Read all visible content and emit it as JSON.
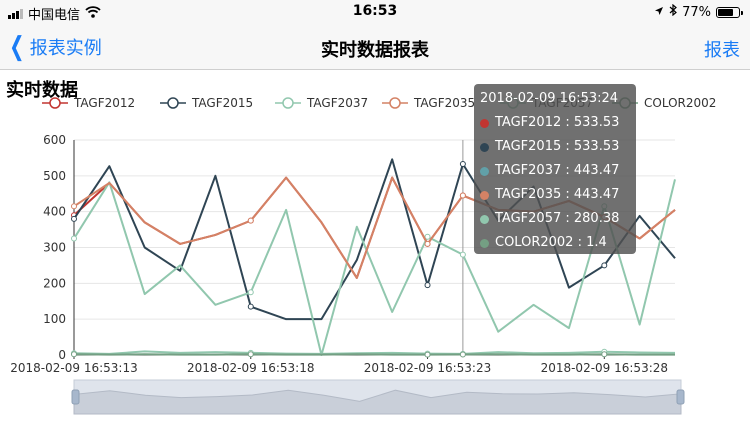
{
  "status_bar": {
    "carrier": "中国电信",
    "time": "16:53",
    "battery": "77%",
    "battery_level": 0.77
  },
  "nav": {
    "back_label": "报表实例",
    "title": "实时数据报表",
    "right_label": "报表"
  },
  "section_title": "实时数据",
  "tooltip": {
    "title": "2018-02-09 16:53:24",
    "rows": [
      {
        "text": "TAGF2012 : 533.53",
        "color": "#c23531"
      },
      {
        "text": "TAGF2015 : 533.53",
        "color": "#2f4554"
      },
      {
        "text": "TAGF2037 : 443.47",
        "color": "#61a0a8"
      },
      {
        "text": "TAGF2035 : 443.47",
        "color": "#d48265"
      },
      {
        "text": "TAGF2057 : 280.38",
        "color": "#91c7ae"
      },
      {
        "text": "COLOR2002 : 1.4",
        "color": "#749f83"
      }
    ]
  },
  "chart_data": {
    "type": "line",
    "ylim": [
      0,
      600
    ],
    "yticks": [
      "0",
      "100",
      "200",
      "300",
      "400",
      "500",
      "600"
    ],
    "x_tick_labels": [
      "2018-02-09 16:53:13",
      "2018-02-09 16:53:18",
      "2018-02-09 16:53:23",
      "2018-02-09 16:53:28"
    ],
    "series": [
      {
        "name": "TAGF2012",
        "color": "#c23531",
        "values": [
          390,
          480,
          370,
          310,
          335,
          375,
          495,
          370,
          215,
          495,
          310,
          445,
          405,
          400,
          430,
          385,
          325,
          405
        ]
      },
      {
        "name": "TAGF2015",
        "color": "#2f4554",
        "values": [
          380,
          527,
          300,
          235,
          500,
          135,
          100,
          100,
          265,
          546,
          195,
          533,
          375,
          470,
          188,
          250,
          388,
          270
        ]
      },
      {
        "name": "TAGF2037",
        "color": "#91c7ae",
        "values": [
          325,
          482,
          170,
          250,
          140,
          175,
          405,
          0,
          358,
          120,
          330,
          280,
          65,
          140,
          75,
          415,
          85,
          490
        ]
      },
      {
        "name": "TAGF2035",
        "color": "#d48265",
        "values": [
          415,
          480,
          370,
          310,
          335,
          375,
          495,
          370,
          215,
          495,
          310,
          445,
          405,
          400,
          430,
          385,
          325,
          405
        ]
      },
      {
        "name": "TAGF2057",
        "color": "#91c7ae",
        "values": [
          5,
          3,
          10,
          6,
          8,
          6,
          4,
          3,
          5,
          6,
          4,
          3,
          8,
          5,
          6,
          9,
          7,
          6
        ]
      },
      {
        "name": "COLOR2002",
        "color": "#749f83",
        "values": [
          2,
          1,
          2,
          1,
          1,
          2,
          1,
          1,
          2,
          1,
          1,
          1.4,
          2,
          1,
          1,
          2,
          1,
          1
        ]
      }
    ],
    "tooltip_index": 11
  }
}
